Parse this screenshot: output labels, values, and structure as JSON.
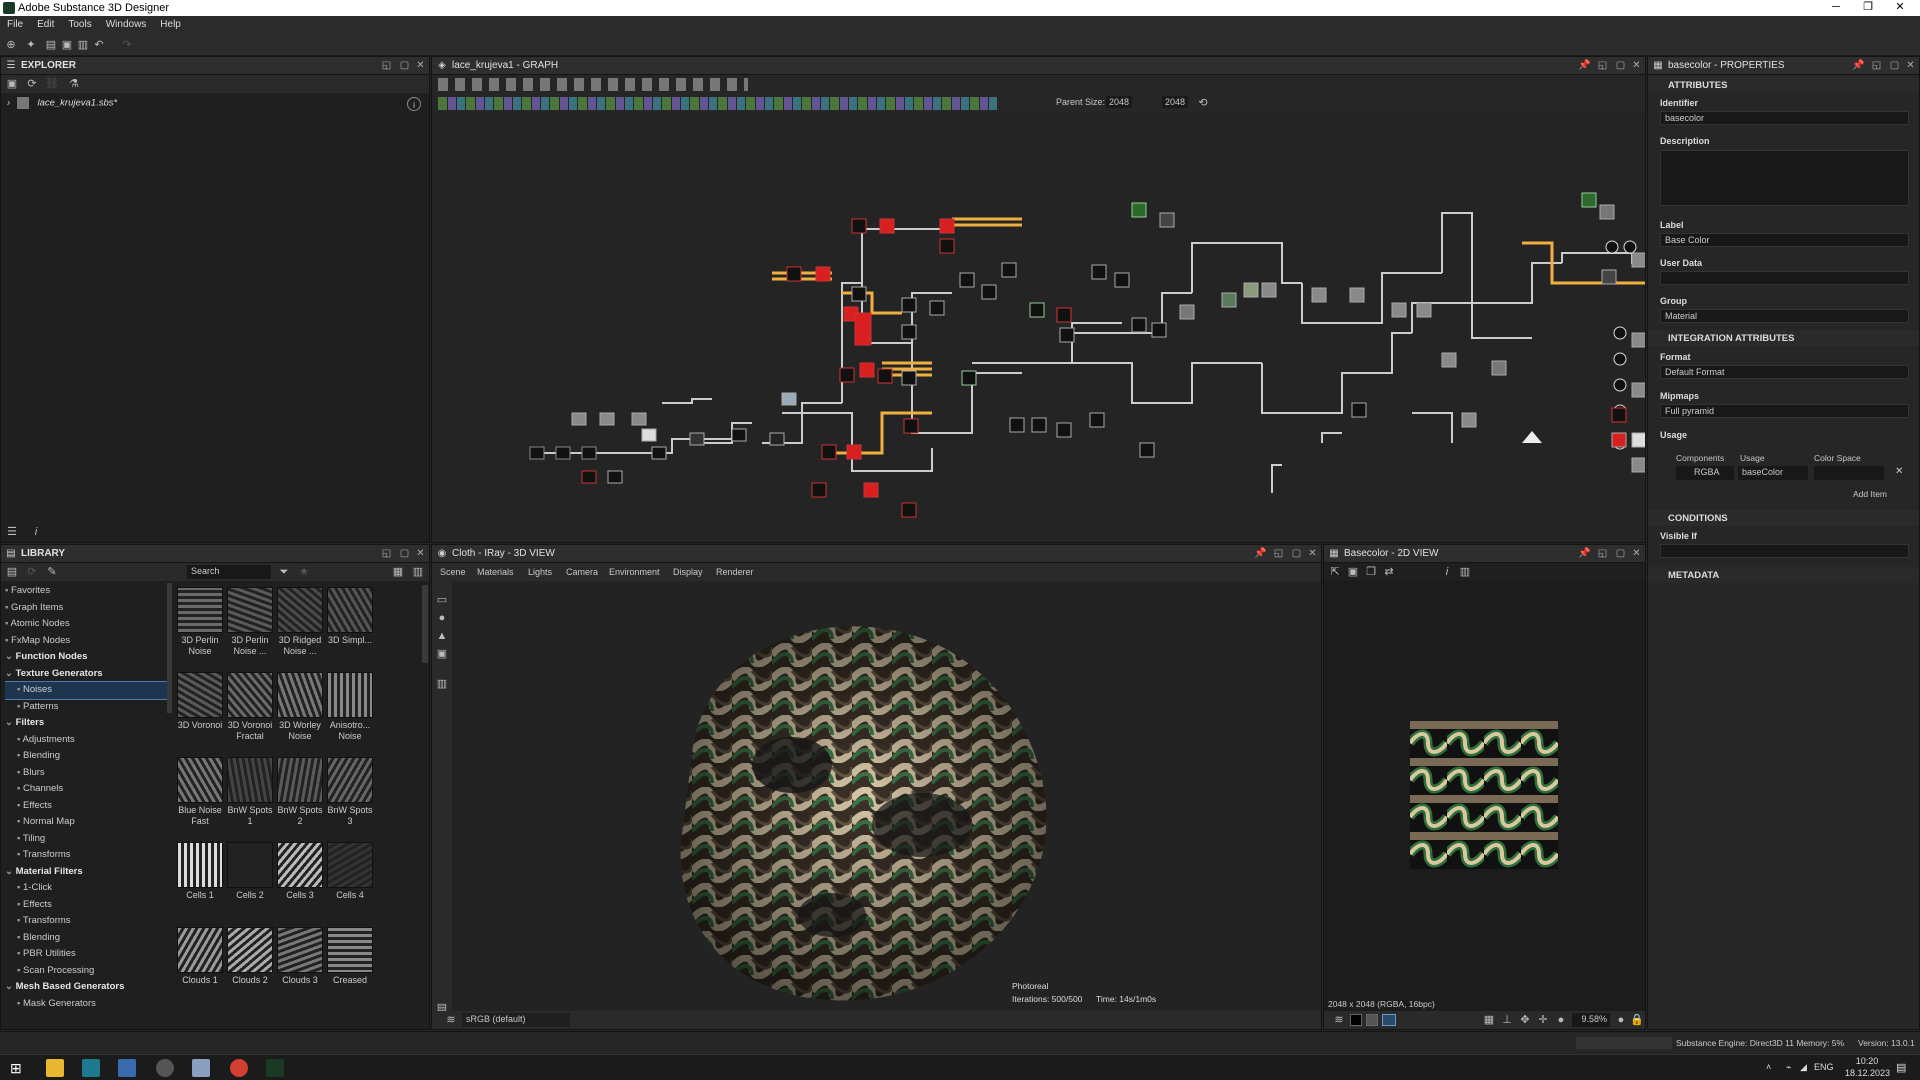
{
  "app": {
    "title": "Adobe Substance 3D Designer"
  },
  "menu": [
    "File",
    "Edit",
    "Tools",
    "Windows",
    "Help"
  ],
  "explorer": {
    "title": "EXPLORER",
    "file": "lace_krujeva1.sbs*"
  },
  "graph": {
    "title": "lace_krujeva1 - GRAPH",
    "parent_size_label": "Parent Size:",
    "parent_size": "2048",
    "size": "2048"
  },
  "properties": {
    "title": "basecolor - PROPERTIES",
    "sections": {
      "attributes": "ATTRIBUTES",
      "integration": "INTEGRATION ATTRIBUTES",
      "conditions": "CONDITIONS",
      "metadata": "METADATA"
    },
    "identifier_label": "Identifier",
    "identifier": "basecolor",
    "description_label": "Description",
    "label_label": "Label",
    "label": "Base Color",
    "userdata_label": "User Data",
    "group_label": "Group",
    "group": "Material",
    "format_label": "Format",
    "format": "Default Format",
    "mipmaps_label": "Mipmaps",
    "mipmaps": "Full pyramid",
    "usage_label": "Usage",
    "cols": {
      "components": "Components",
      "usage": "Usage",
      "colorspace": "Color Space"
    },
    "components": "RGBA",
    "usage_val": "baseColor",
    "add_item": "Add Item",
    "visible_if_label": "Visible If"
  },
  "library": {
    "title": "LIBRARY",
    "search_placeholder": "Search",
    "tree": [
      {
        "label": "Favorites",
        "type": "item"
      },
      {
        "label": "Graph Items",
        "type": "item"
      },
      {
        "label": "Atomic Nodes",
        "type": "item"
      },
      {
        "label": "FxMap Nodes",
        "type": "item"
      },
      {
        "label": "Function Nodes",
        "type": "grp"
      },
      {
        "label": "Texture Generators",
        "type": "grp"
      },
      {
        "label": "Noises",
        "type": "sel"
      },
      {
        "label": "Patterns",
        "type": "sub"
      },
      {
        "label": "Filters",
        "type": "grp"
      },
      {
        "label": "Adjustments",
        "type": "sub"
      },
      {
        "label": "Blending",
        "type": "sub"
      },
      {
        "label": "Blurs",
        "type": "sub"
      },
      {
        "label": "Channels",
        "type": "sub"
      },
      {
        "label": "Effects",
        "type": "sub"
      },
      {
        "label": "Normal Map",
        "type": "sub"
      },
      {
        "label": "Tiling",
        "type": "sub"
      },
      {
        "label": "Transforms",
        "type": "sub"
      },
      {
        "label": "Material Filters",
        "type": "grp"
      },
      {
        "label": "1-Click",
        "type": "sub"
      },
      {
        "label": "Effects",
        "type": "sub"
      },
      {
        "label": "Transforms",
        "type": "sub"
      },
      {
        "label": "Blending",
        "type": "sub"
      },
      {
        "label": "PBR Utilities",
        "type": "sub"
      },
      {
        "label": "Scan Processing",
        "type": "sub"
      },
      {
        "label": "Mesh Based Generators",
        "type": "grp"
      },
      {
        "label": "Mask Generators",
        "type": "sub"
      }
    ],
    "thumbs": [
      [
        "3D Perlin Noise",
        "3D Perlin Noise ...",
        "3D Ridged Noise ...",
        "3D Simpl..."
      ],
      [
        "3D Voronoi",
        "3D Voronoi Fractal",
        "3D Worley Noise",
        "Anisotro... Noise"
      ],
      [
        "Blue Noise Fast",
        "BnW Spots 1",
        "BnW Spots 2",
        "BnW Spots 3"
      ],
      [
        "Cells 1",
        "Cells 2",
        "Cells 3",
        "Cells 4"
      ],
      [
        "Clouds 1",
        "Clouds 2",
        "Clouds 3",
        "Creased"
      ]
    ]
  },
  "view3d": {
    "title": "Cloth - IRay - 3D VIEW",
    "tabs": [
      "Scene",
      "Materials",
      "Lights",
      "Camera",
      "Environment",
      "Display",
      "Renderer"
    ],
    "mode": "Photoreal",
    "iterations": "Iterations: 500/500",
    "time": "Time: 14s/1m0s",
    "colorspace": "sRGB (default)"
  },
  "view2d": {
    "title": "Basecolor - 2D VIEW",
    "info": "2048 x 2048 (RGBA, 16bpc)",
    "zoom": "9.58%"
  },
  "status": {
    "engine": "Substance Engine: Direct3D 11  Memory: 5%",
    "version": "Version: 13.0.1"
  },
  "taskbar": {
    "lang": "ENG",
    "time": "10:20",
    "date": "18.12.2023"
  },
  "colors": {
    "accent_orange": "#f0b040",
    "node_red": "#d82020",
    "sel_blue": "#4a7ab0"
  }
}
